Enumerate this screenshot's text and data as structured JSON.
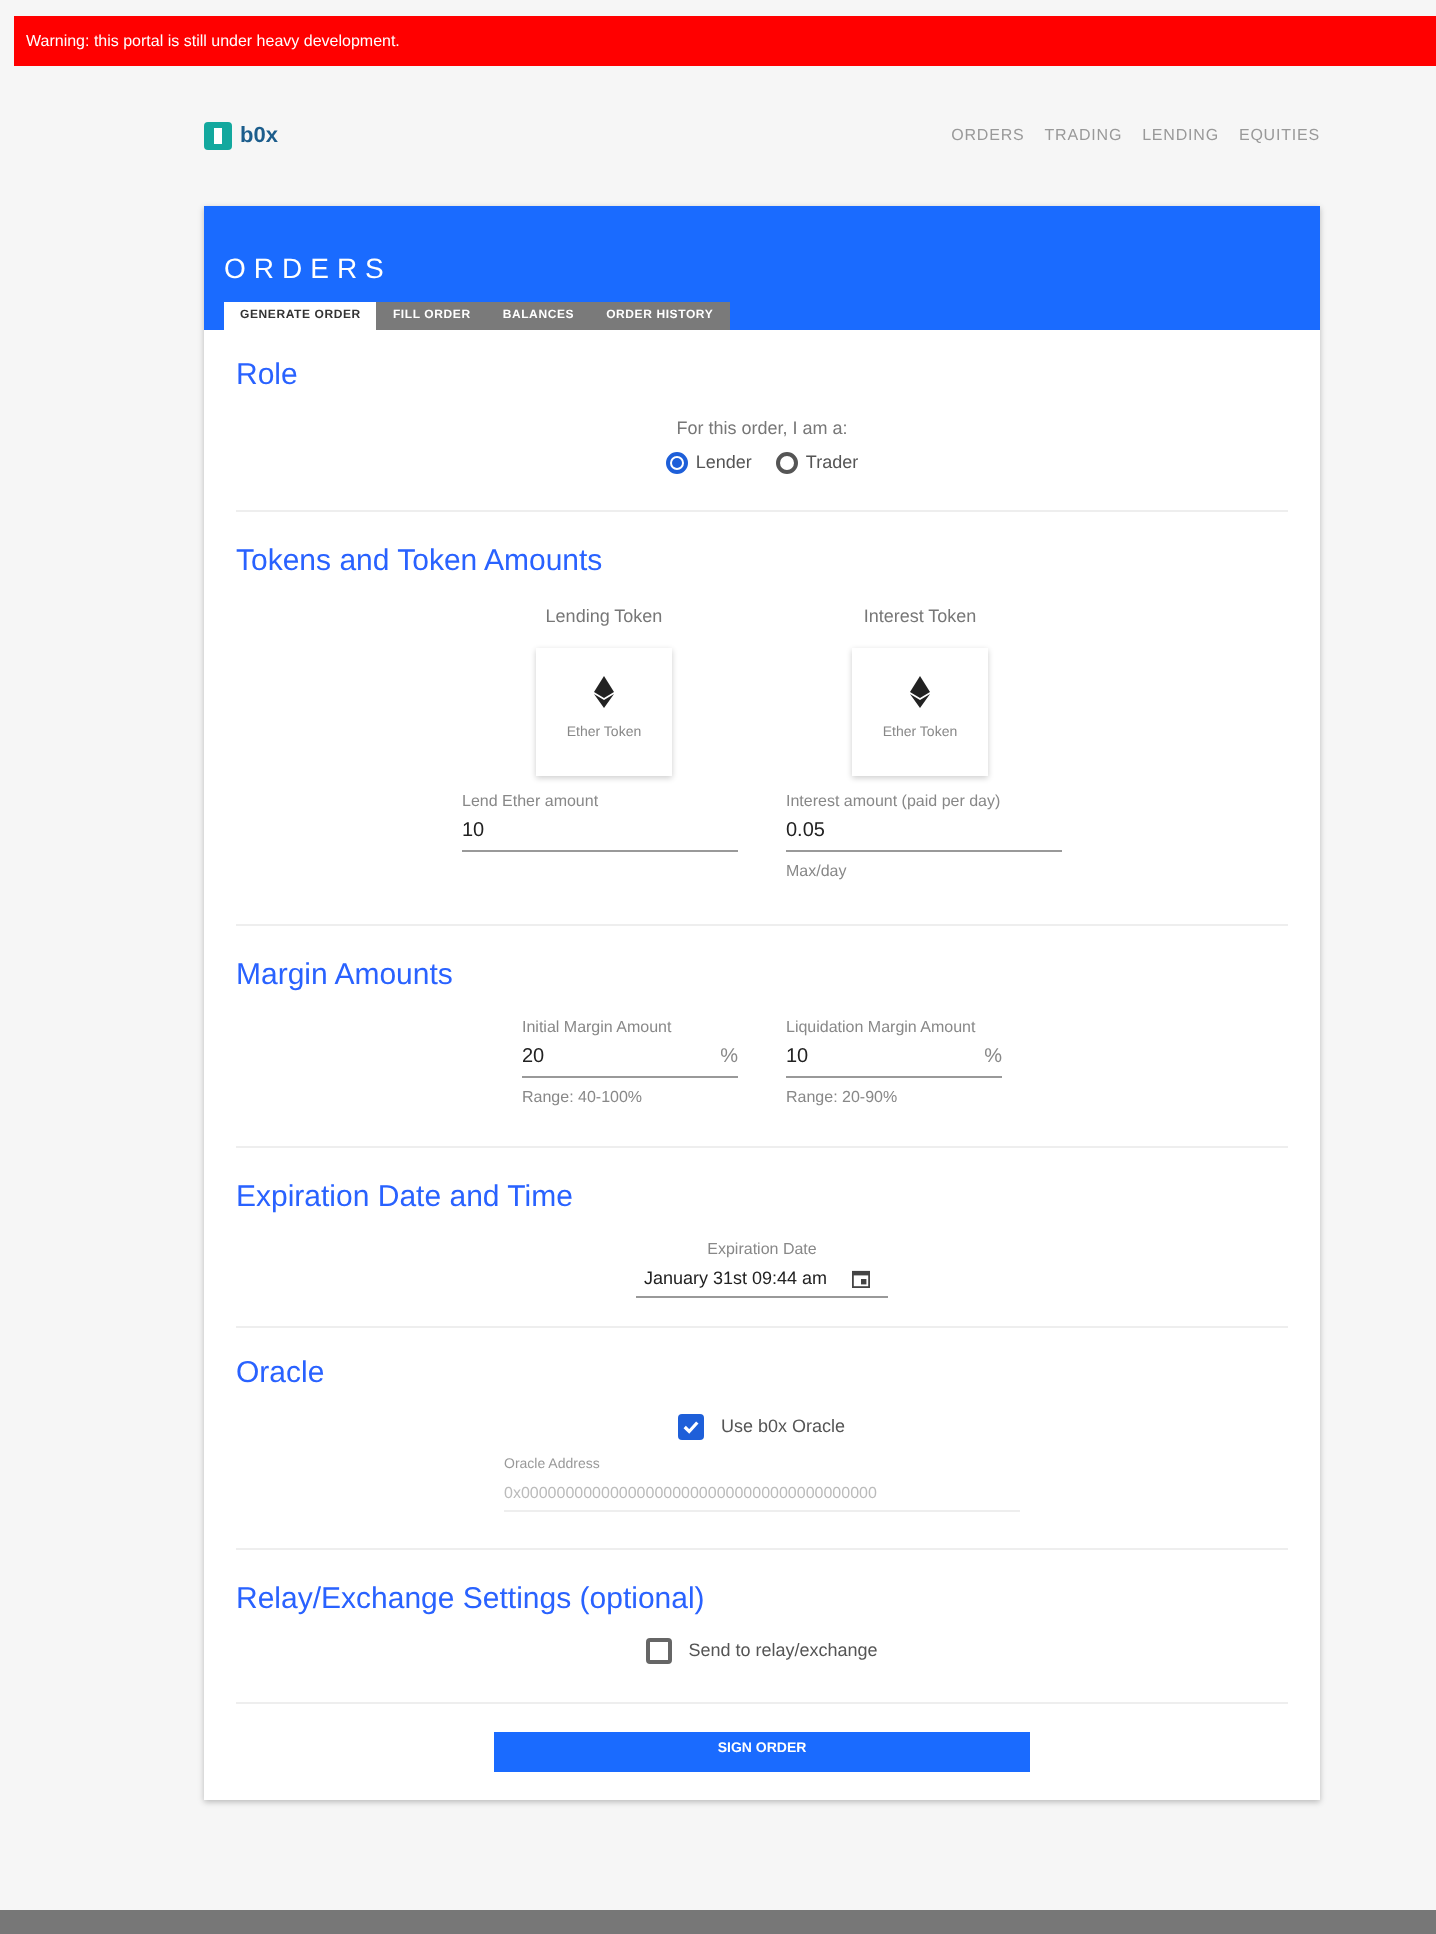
{
  "banner": {
    "text": "Warning: this portal is still under heavy development."
  },
  "header": {
    "logo_text": "b0x",
    "nav": [
      {
        "label": "ORDERS"
      },
      {
        "label": "TRADING"
      },
      {
        "label": "LENDING"
      },
      {
        "label": "EQUITIES"
      }
    ]
  },
  "card": {
    "title": "ORDERS",
    "tabs": [
      {
        "label": "GENERATE ORDER",
        "selected": true
      },
      {
        "label": "FILL ORDER",
        "selected": false
      },
      {
        "label": "BALANCES",
        "selected": false
      },
      {
        "label": "ORDER HISTORY",
        "selected": false
      }
    ],
    "role": {
      "heading": "Role",
      "prompt": "For this order, I am a:",
      "options": [
        {
          "label": "Lender",
          "selected": true
        },
        {
          "label": "Trader",
          "selected": false
        }
      ]
    },
    "tokens": {
      "heading": "Tokens and Token Amounts",
      "pickers": [
        {
          "label": "Lending Token",
          "token": "Ether Token"
        },
        {
          "label": "Interest Token",
          "token": "Ether Token"
        }
      ],
      "fields": [
        {
          "label": "Lend Ether amount",
          "value": "10"
        },
        {
          "label": "Interest amount (paid per day)",
          "value": "0.05",
          "helper": "Max/day"
        }
      ]
    },
    "margin": {
      "heading": "Margin Amounts",
      "fields": [
        {
          "label": "Initial Margin Amount",
          "value": "20",
          "unit": "%",
          "helper": "Range: 40-100%"
        },
        {
          "label": "Liquidation Margin Amount",
          "value": "10",
          "unit": "%",
          "helper": "Range: 20-90%"
        }
      ]
    },
    "expiration": {
      "heading": "Expiration Date and Time",
      "label": "Expiration Date",
      "value": "January 31st 09:44 am"
    },
    "oracle": {
      "heading": "Oracle",
      "checkbox": {
        "label": "Use b0x Oracle",
        "checked": true
      },
      "address_label": "Oracle Address",
      "address": "0x0000000000000000000000000000000000000000"
    },
    "relay": {
      "heading": "Relay/Exchange Settings (optional)",
      "checkbox": {
        "label": "Send to relay/exchange",
        "checked": false
      }
    },
    "submit": "SIGN ORDER"
  }
}
